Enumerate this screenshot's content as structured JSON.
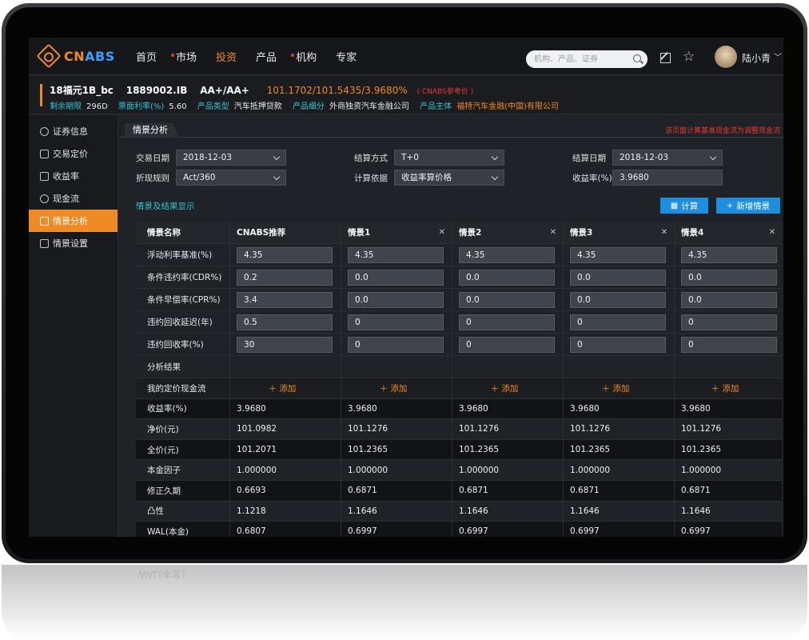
{
  "nav": {
    "logo_text_a": "CN",
    "logo_text_b": "ABS",
    "items": [
      "首页",
      "市场",
      "投资",
      "产品",
      "机构",
      "专家"
    ],
    "search_placeholder": "机构、产品、证券",
    "user_name": "陆小青"
  },
  "info": {
    "name": "18福元1B_bc",
    "code": "1889002.IB",
    "rating": "AA+/AA+",
    "price": "101.1702/101.5435/3.9680%",
    "price_note": "( CNABS参考价 )",
    "fields": [
      {
        "k": "剩余期限",
        "v": "296D"
      },
      {
        "k": "票面利率(%)",
        "v": "5.60"
      },
      {
        "k": "产品类型",
        "v": "汽车抵押贷款"
      },
      {
        "k": "产品细分",
        "v": "外商独资汽车金融公司"
      },
      {
        "k": "产品主体",
        "v": "福特汽车金融(中国)有限公司"
      }
    ]
  },
  "sidebar": {
    "items": [
      "证券信息",
      "交易定价",
      "收益率",
      "现金流",
      "情景分析",
      "情景设置"
    ],
    "active_index": 4
  },
  "main": {
    "tab": "情景分析",
    "note": "该页面计算基准现金流为调整现金流",
    "form": {
      "trade_date_label": "交易日期",
      "trade_date": "2018-12-03",
      "settle_method_label": "结算方式",
      "settle_method": "T+0",
      "settle_date_label": "结算日期",
      "settle_date": "2018-12-03",
      "discount_label": "折现规则",
      "discount": "Act/360",
      "calc_basis_label": "计算依据",
      "calc_basis": "收益率算价格",
      "yield_label": "收益率(%)",
      "yield": "3.9680"
    },
    "section_title": "情景及结果显示",
    "calc_button": "计算",
    "add_scenario_button": "新增情景",
    "add_label": "添加"
  },
  "table": {
    "header": [
      "情景名称",
      "CNABS推荐",
      "情景1",
      "情景2",
      "情景3",
      "情景4"
    ],
    "inputs": [
      {
        "label": "浮动利率基准(%)",
        "values": [
          "4.35",
          "4.35",
          "4.35",
          "4.35",
          "4.35"
        ]
      },
      {
        "label": "条件违约率(CDR%)",
        "values": [
          "0.2",
          "0.0",
          "0.0",
          "0.0",
          "0.0"
        ]
      },
      {
        "label": "条件早偿率(CPR%)",
        "values": [
          "3.4",
          "0.0",
          "0.0",
          "0.0",
          "0.0"
        ]
      },
      {
        "label": "违约回收延迟(年)",
        "values": [
          "0.5",
          "0",
          "0",
          "0",
          "0"
        ]
      },
      {
        "label": "违约回收率(%)",
        "values": [
          "30",
          "0",
          "0",
          "0",
          "0"
        ]
      }
    ],
    "analysis_label": "分析结果",
    "cashflow_label": "我的定价现金流",
    "results": [
      {
        "label": "收益率(%)",
        "values": [
          "3.9680",
          "3.9680",
          "3.9680",
          "3.9680",
          "3.9680"
        ]
      },
      {
        "label": "净价(元)",
        "values": [
          "101.0982",
          "101.1276",
          "101.1276",
          "101.1276",
          "101.1276"
        ]
      },
      {
        "label": "全价(元)",
        "values": [
          "101.2071",
          "101.2365",
          "101.2365",
          "101.2365",
          "101.2365"
        ]
      },
      {
        "label": "本金因子",
        "values": [
          "1.000000",
          "1.000000",
          "1.000000",
          "1.000000",
          "1.000000"
        ]
      },
      {
        "label": "修正久期",
        "values": [
          "0.6693",
          "0.6871",
          "0.6871",
          "0.6871",
          "0.6871"
        ]
      },
      {
        "label": "凸性",
        "values": [
          "1.1218",
          "1.1646",
          "1.1646",
          "1.1646",
          "1.1646"
        ]
      },
      {
        "label": "WAL(本金)",
        "values": [
          "0.6807",
          "0.6997",
          "0.6997",
          "0.6997",
          "0.6997"
        ]
      }
    ]
  },
  "reflection_text": "WAL(本金)"
}
